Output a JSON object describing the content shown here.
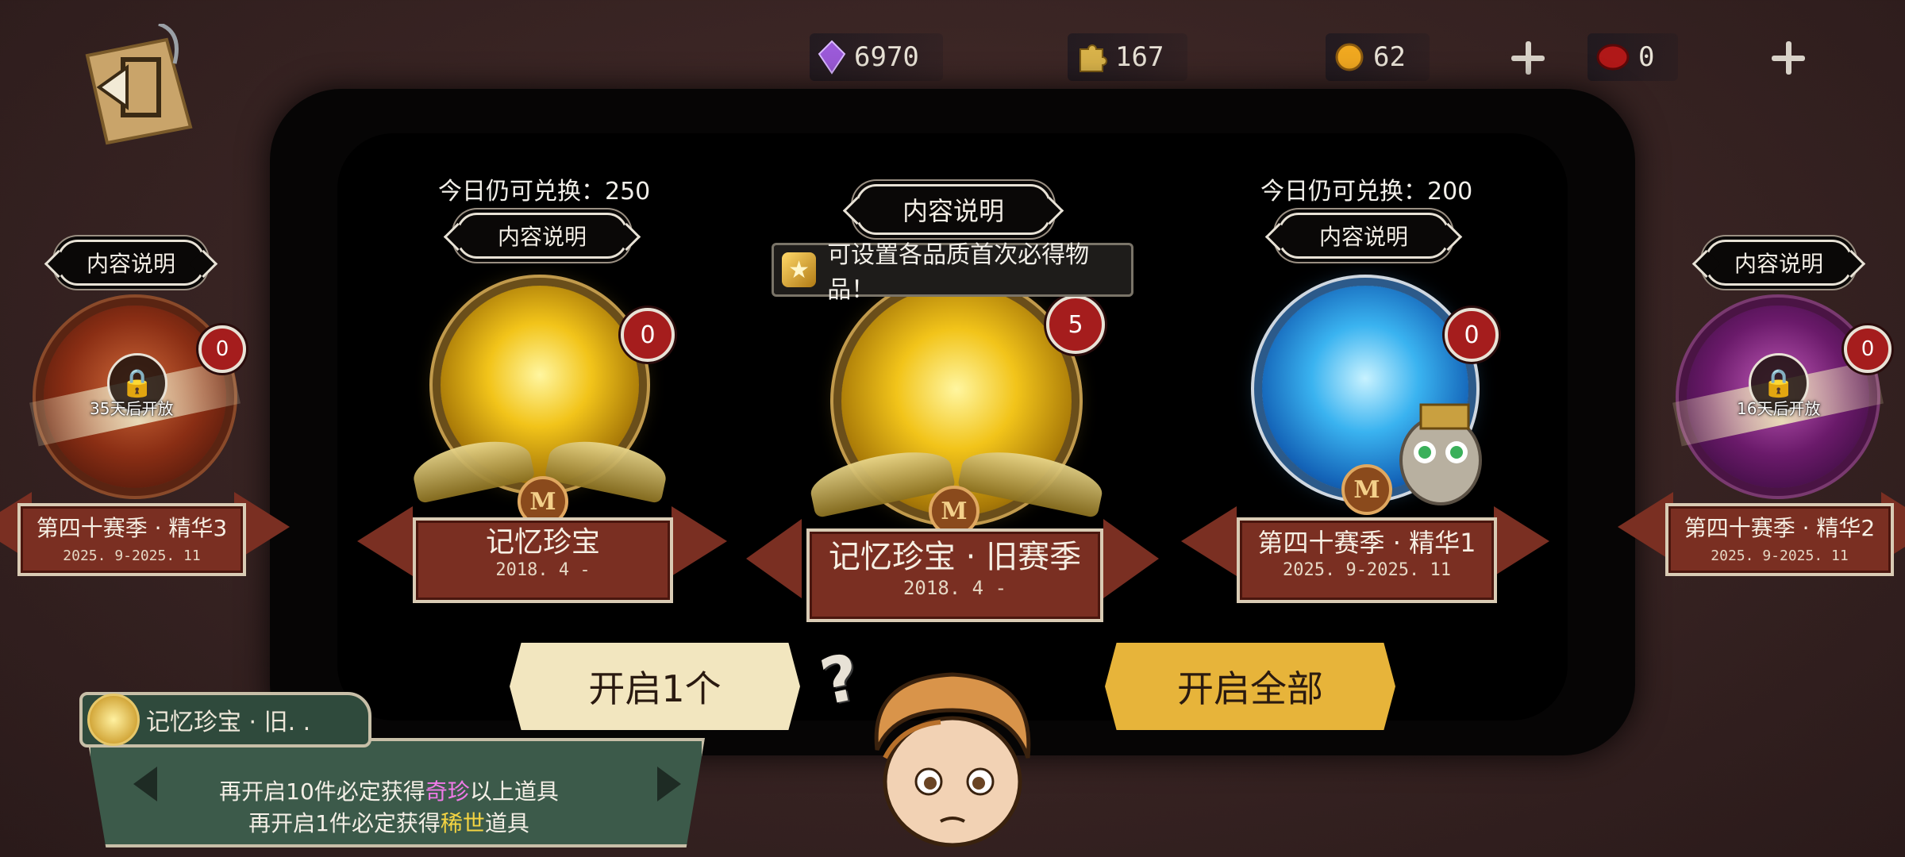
{
  "currency": [
    {
      "icon": "purple-crystal-icon",
      "value": "6970"
    },
    {
      "icon": "puzzle-piece-icon",
      "value": "167"
    },
    {
      "icon": "gold-coin-icon",
      "value": "62"
    },
    {
      "icon": "red-seal-icon",
      "value": "0"
    }
  ],
  "tooltip": {
    "text": "可设置各品质首次必得物品！"
  },
  "cards": [
    {
      "id": "season40-elite3",
      "title": "第四十赛季 · 精华3",
      "dates": "2025. 9-2025. 11",
      "content_label": "内容说明",
      "count": "0",
      "locked_text": "35天后开放"
    },
    {
      "id": "memory-treasure",
      "title": "记忆珍宝",
      "dates": "2018. 4 -",
      "content_label": "内容说明",
      "count": "0",
      "quota": "今日仍可兑换：250"
    },
    {
      "id": "memory-treasure-old",
      "title": "记忆珍宝 · 旧赛季",
      "dates": "2018. 4 -",
      "content_label": "内容说明",
      "count": "5"
    },
    {
      "id": "season40-elite1",
      "title": "第四十赛季 · 精华1",
      "dates": "2025. 9-2025. 11",
      "content_label": "内容说明",
      "count": "0",
      "quota": "今日仍可兑换：200"
    },
    {
      "id": "season40-elite2",
      "title": "第四十赛季 · 精华2",
      "dates": "2025. 9-2025. 11",
      "content_label": "内容说明",
      "count": "0",
      "locked_text": "16天后开放"
    }
  ],
  "buttons": {
    "open_one": "开启1个",
    "open_all": "开启全部"
  },
  "info": {
    "title": "记忆珍宝 · 旧. .",
    "line1_pre": "再开启10件必定获得",
    "line1_hl": "奇珍",
    "line1_post": "以上道具",
    "line2_pre": "再开启1件必定获得",
    "line2_hl": "稀世",
    "line2_post": "道具"
  },
  "colors": {
    "accent_gold": "#e7b43a",
    "banner": "#7a2f22",
    "badge": "#a51d1d",
    "rare_pink": "#f07ae8",
    "legend_yellow": "#f4d442"
  }
}
